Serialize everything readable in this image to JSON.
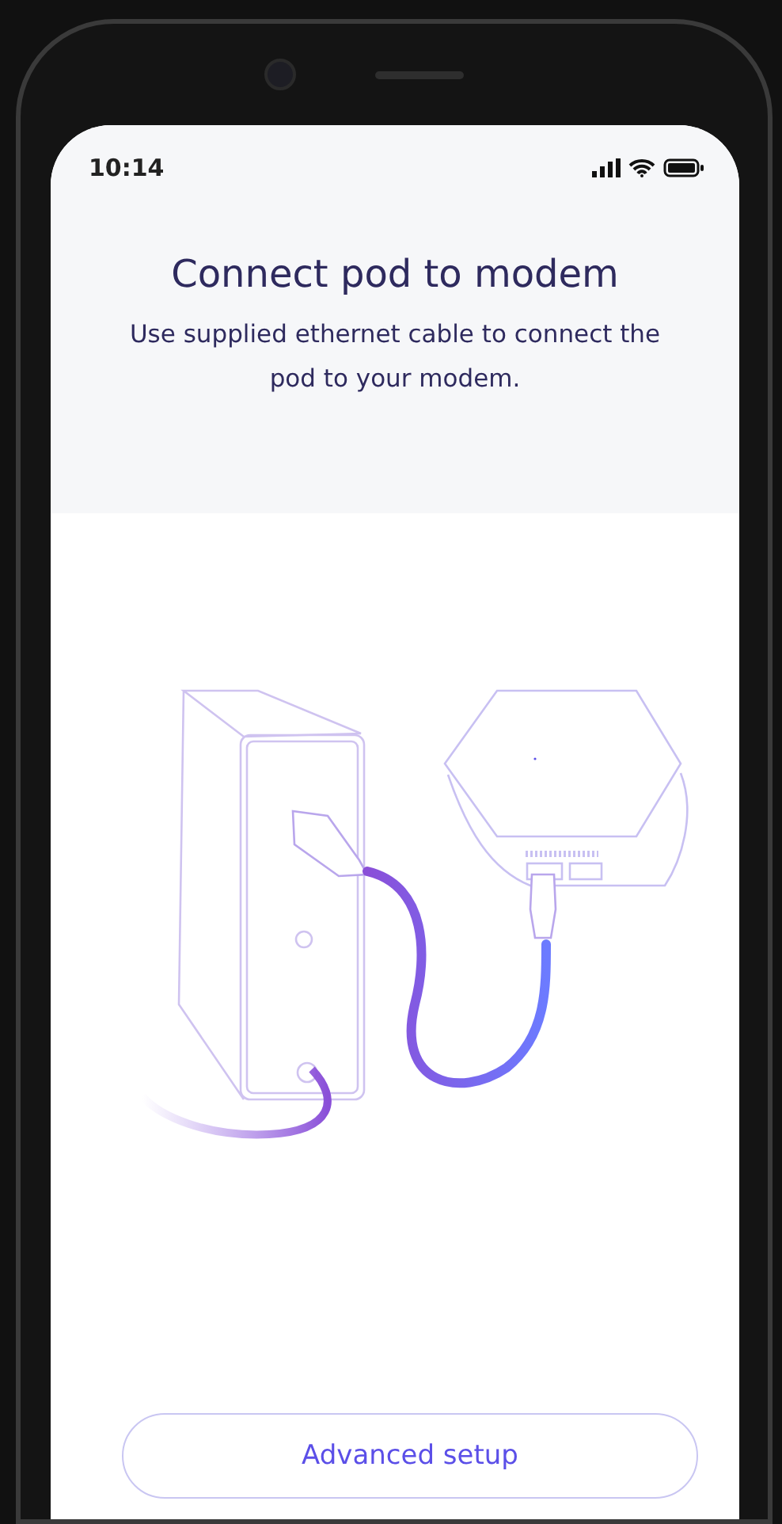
{
  "status_bar": {
    "time": "10:14"
  },
  "header": {
    "title": "Connect pod to modem",
    "subtitle": "Use supplied ethernet cable to connect the pod to your modem."
  },
  "buttons": [
    {
      "label": "Advanced setup"
    }
  ]
}
